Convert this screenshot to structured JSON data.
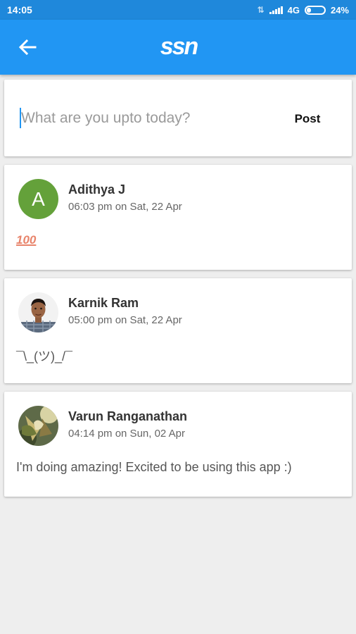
{
  "status_bar": {
    "time": "14:05",
    "network": "4G",
    "battery": "24%",
    "battery_level": 0.24,
    "icons": [
      "data-arrows-icon",
      "signal-icon",
      "battery-icon"
    ]
  },
  "app_bar": {
    "back_icon": "arrow-left-icon",
    "logo": "ssn",
    "color": "#2196f3"
  },
  "composer": {
    "placeholder": "What are you upto today?",
    "value": "",
    "post_label": "Post"
  },
  "posts": [
    {
      "author": "Adithya J",
      "timestamp": "06:03 pm on Sat, 22 Apr",
      "avatar_letter": "A",
      "avatar_color": "#64a13a",
      "body": "100"
    },
    {
      "author": "Karnik Ram",
      "timestamp": "05:00 pm on Sat, 22 Apr",
      "avatar": "photo-portrait",
      "body": "¯\\_(ツ)_/¯"
    },
    {
      "author": "Varun Ranganathan",
      "timestamp": "04:14 pm on Sun, 02 Apr",
      "avatar": "photo-artwork",
      "body": "I'm doing amazing! Excited to be using this app :)"
    }
  ]
}
